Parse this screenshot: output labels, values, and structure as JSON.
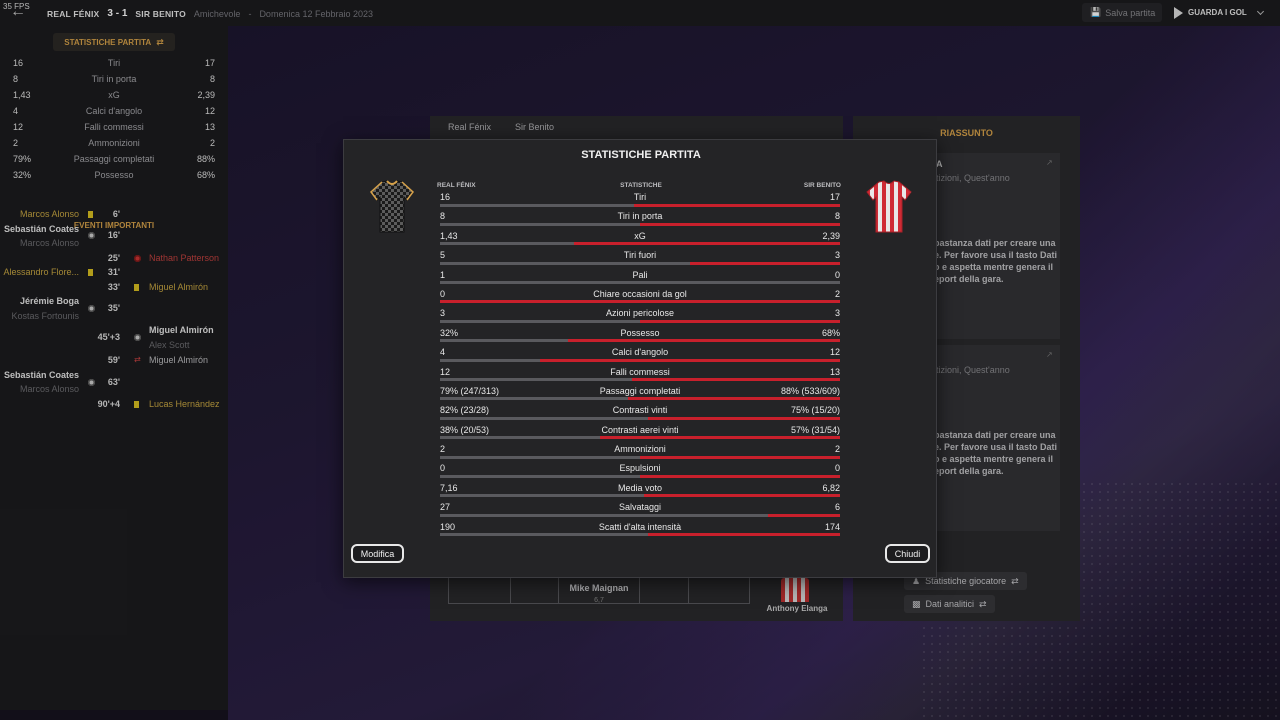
{
  "topbar": {
    "fps": "35 FPS",
    "home_team": "REAL FÉNIX",
    "score": "3 - 1",
    "away_team": "SIR BENITO",
    "competition": "Amichevole",
    "separator": "-",
    "date": "Domenica 12 Febbraio 2023",
    "save_label": "Salva partita",
    "goals_label": "GUARDA I GOL"
  },
  "left": {
    "tab_label": "STATISTICHE PARTITA",
    "stats": [
      {
        "label": "Tiri",
        "home": "16",
        "away": "17"
      },
      {
        "label": "Tiri in porta",
        "home": "8",
        "away": "8"
      },
      {
        "label": "xG",
        "home": "1,43",
        "away": "2,39"
      },
      {
        "label": "Calci d'angolo",
        "home": "4",
        "away": "12"
      },
      {
        "label": "Falli commessi",
        "home": "12",
        "away": "13"
      },
      {
        "label": "Ammonizioni",
        "home": "2",
        "away": "2"
      },
      {
        "label": "Passaggi completati",
        "home": "79%",
        "away": "88%"
      },
      {
        "label": "Possesso",
        "home": "32%",
        "away": "68%"
      }
    ],
    "events_title": "EVENTI IMPORTANTI",
    "events": {
      "e1": {
        "name": "Marcos Alonso",
        "minute": "6'"
      },
      "e2": {
        "name": "Sebastián Coates",
        "assist": "Marcos Alonso",
        "minute": "16'"
      },
      "e3": {
        "name": "Nathan Patterson",
        "minute": "25'"
      },
      "e4": {
        "name": "Alessandro Flore...",
        "minute": "31'"
      },
      "e5": {
        "name": "Miguel Almirón",
        "minute": "33'"
      },
      "e6": {
        "name": "Jérémie Boga",
        "assist": "Kostas Fortounis",
        "minute": "35'"
      },
      "e7": {
        "name": "Miguel Almirón",
        "assist": "Alex Scott",
        "minute": "45'+3"
      },
      "e8": {
        "name": "Miguel Almirón",
        "minute": "59'"
      },
      "e9": {
        "name": "Sebastián Coates",
        "assist": "Marcos Alonso",
        "minute": "63'"
      },
      "e10": {
        "name": "Lucas Hernández",
        "minute": "90'+4"
      }
    }
  },
  "center": {
    "tab_home": "Real Fénix",
    "tab_away": "Sir Benito",
    "gk_name": "Mike Maignan",
    "gk_rating": "6,7",
    "player_name": "Anthony Elanga"
  },
  "right": {
    "title": "RIASSUNTO",
    "card1_title": "A",
    "card1_sub": "tizioni, Quest'anno",
    "card1_text": "bastanza dati per creare una e. Per favore usa il tasto Dati o e aspetta mentre genera il eport della gara.",
    "card2_sub": "tizioni, Quest'anno",
    "card2_text": "bastanza dati per creare una e. Per favore usa il tasto Dati o e aspetta mentre genera il eport della gara.",
    "btn_player_stats": "Statistiche giocatore",
    "btn_analytics": "Dati analitici"
  },
  "modal": {
    "title": "STATISTICHE PARTITA",
    "header_home": "REAL FÉNIX",
    "header_center": "STATISTICHE",
    "header_away": "SIR BENITO",
    "rows": [
      {
        "label": "Tiri",
        "home": "16",
        "away": "17",
        "home_share": 0.485
      },
      {
        "label": "Tiri in porta",
        "home": "8",
        "away": "8",
        "home_share": 0.5
      },
      {
        "label": "xG",
        "home": "1,43",
        "away": "2,39",
        "home_share": 0.335
      },
      {
        "label": "Tiri fuori",
        "home": "5",
        "away": "3",
        "home_share": 0.625
      },
      {
        "label": "Pali",
        "home": "1",
        "away": "0",
        "home_share": 1.0
      },
      {
        "label": "Chiare occasioni da gol",
        "home": "0",
        "away": "2",
        "home_share": 0.0
      },
      {
        "label": "Azioni pericolose",
        "home": "3",
        "away": "3",
        "home_share": 0.5
      },
      {
        "label": "Possesso",
        "home": "32%",
        "away": "68%",
        "home_share": 0.32
      },
      {
        "label": "Calci d'angolo",
        "home": "4",
        "away": "12",
        "home_share": 0.25
      },
      {
        "label": "Falli commessi",
        "home": "12",
        "away": "13",
        "home_share": 0.48
      },
      {
        "label": "Passaggi completati",
        "home": "79% (247/313)",
        "away": "88% (533/609)",
        "home_share": 0.47
      },
      {
        "label": "Contrasti vinti",
        "home": "82% (23/28)",
        "away": "75% (15/20)",
        "home_share": 0.52
      },
      {
        "label": "Contrasti aerei vinti",
        "home": "38% (20/53)",
        "away": "57% (31/54)",
        "home_share": 0.4
      },
      {
        "label": "Ammonizioni",
        "home": "2",
        "away": "2",
        "home_share": 0.5
      },
      {
        "label": "Espulsioni",
        "home": "0",
        "away": "0",
        "home_share": 0.5
      },
      {
        "label": "Media voto",
        "home": "7,16",
        "away": "6,82",
        "home_share": 0.51
      },
      {
        "label": "Salvataggi",
        "home": "27",
        "away": "6",
        "home_share": 0.82
      },
      {
        "label": "Scatti d'alta intensità",
        "home": "190",
        "away": "174",
        "home_share": 0.52
      }
    ],
    "btn_edit": "Modifica",
    "btn_close": "Chiudi"
  },
  "colors": {
    "accent_gold": "#d7a24a",
    "away_red": "#c8202c",
    "home_grey": "#5a5a5e"
  }
}
